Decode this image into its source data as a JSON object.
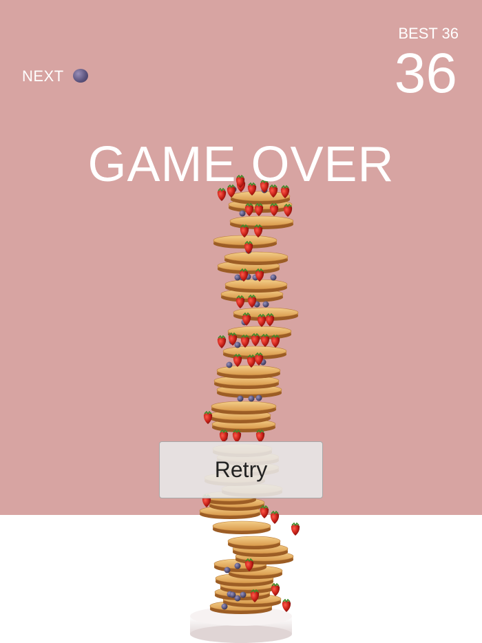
{
  "hud": {
    "next_label": "NEXT",
    "next_item_icon": "blueberry-icon",
    "best_label": "BEST 36",
    "score": "36"
  },
  "overlay": {
    "title": "GAME OVER",
    "retry_label": "Retry"
  },
  "colors": {
    "background": "#d7a4a2",
    "floor": "#ffffff",
    "pancake": "#e6b56c",
    "pancake_edge": "#a8692a",
    "strawberry": "#c51f17",
    "blueberry": "#5b5880",
    "plate": "#f2ecec"
  }
}
